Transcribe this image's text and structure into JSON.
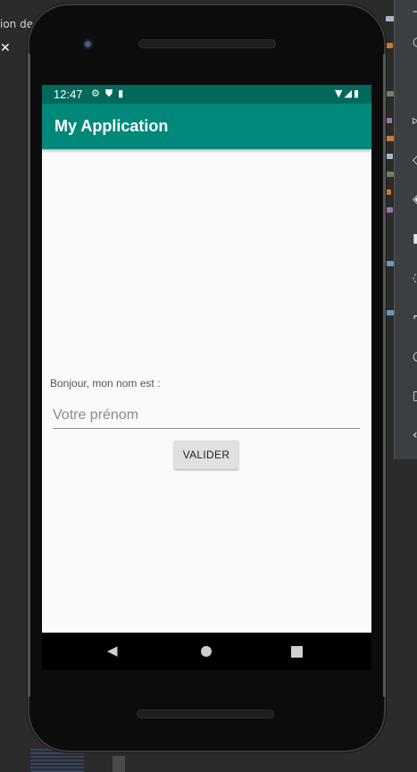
{
  "ide": {
    "left_text": "ion de",
    "close_glyph": "✕"
  },
  "status_bar": {
    "time": "12:47",
    "left_icons": [
      "gear-icon",
      "shield-icon",
      "sd-card-icon"
    ],
    "right_icons": [
      "wifi-icon",
      "signal-icon",
      "battery-icon"
    ]
  },
  "app_bar": {
    "title": "My Application"
  },
  "form": {
    "greeting": "Bonjour, mon nom est :",
    "name_placeholder": "Votre prénom",
    "name_value": "",
    "submit_label": "VALIDER"
  },
  "nav_bar": {
    "buttons": [
      "back",
      "home",
      "recents"
    ]
  },
  "colors": {
    "status_bar": "#00695c",
    "app_bar": "#00897b",
    "screen_bg": "#fafafa",
    "button_bg": "#e0e0e0"
  }
}
